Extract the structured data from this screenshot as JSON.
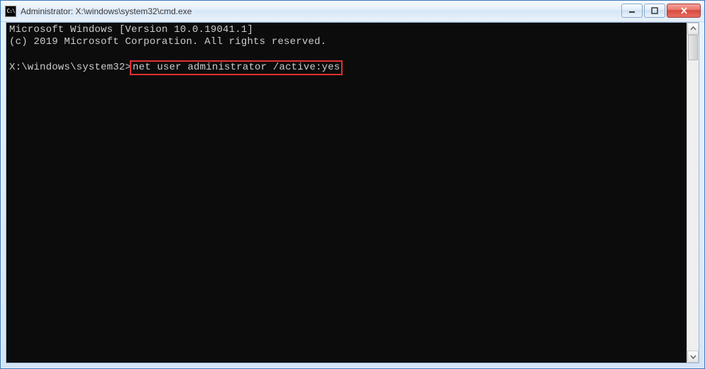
{
  "titlebar": {
    "icon_label": "C:\\",
    "title": "Administrator: X:\\windows\\system32\\cmd.exe"
  },
  "window_controls": {
    "minimize_label": "Minimize",
    "maximize_label": "Maximize",
    "close_label": "Close"
  },
  "terminal": {
    "line1": "Microsoft Windows [Version 10.0.19041.1]",
    "line2": "(c) 2019 Microsoft Corporation. All rights reserved.",
    "blank": "",
    "prompt": "X:\\windows\\system32>",
    "command": "net user administrator /active:yes"
  },
  "scrollbar": {
    "up": "▲",
    "down": "▼"
  }
}
